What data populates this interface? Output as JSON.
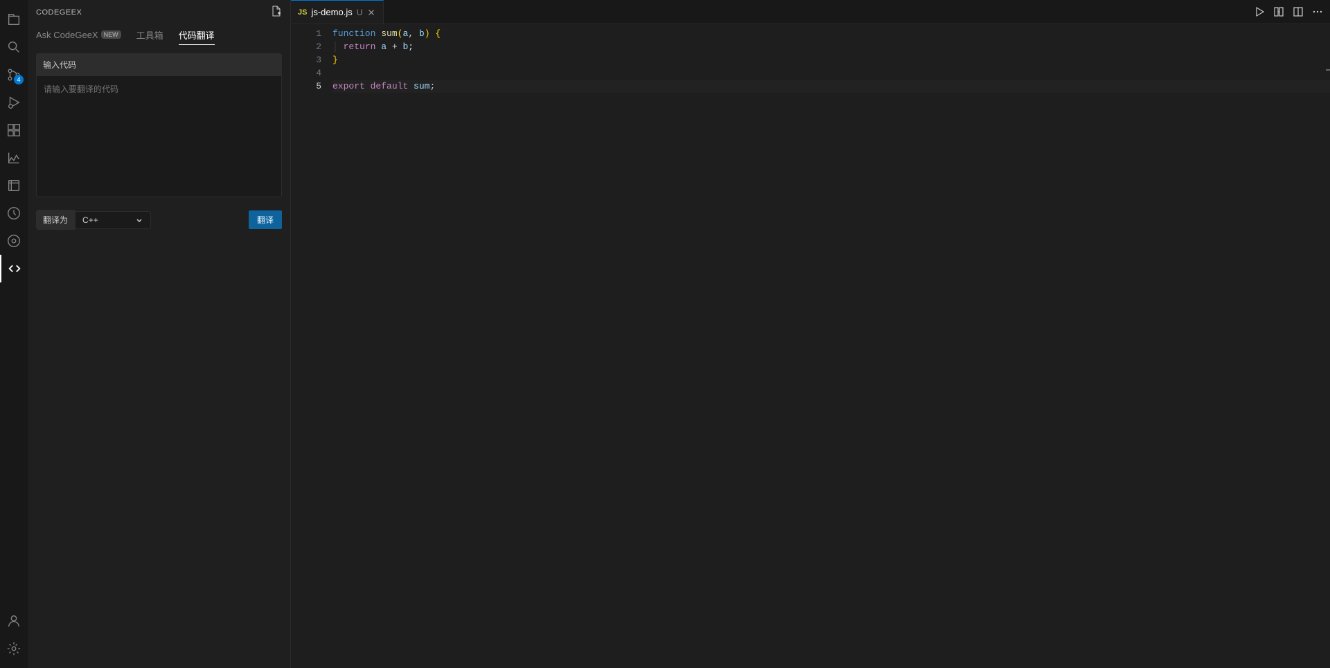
{
  "sidebar": {
    "title": "CODEGEEX",
    "tabs": [
      {
        "label": "Ask CodeGeeX",
        "badge": "NEW"
      },
      {
        "label": "工具箱"
      },
      {
        "label": "代码翻译"
      }
    ],
    "activeTabIndex": 2,
    "inputSection": {
      "label": "输入代码",
      "placeholder": "请输入要翻译的代码"
    },
    "translateLabel": "翻译为",
    "selectedLang": "C++",
    "translateButton": "翻译"
  },
  "activityBar": {
    "scmBadge": "4"
  },
  "editor": {
    "tabs": [
      {
        "icon": "JS",
        "name": "js-demo.js",
        "modified": "U"
      }
    ],
    "activeLine": 5,
    "code": {
      "line1": {
        "kw": "function",
        "fn": "sum",
        "p1": "(",
        "a": "a",
        "c1": ", ",
        "b": "b",
        "p2": ")",
        "sp": " ",
        "br": "{"
      },
      "line2": {
        "indent": "  ",
        "kw": "return",
        "sp": " ",
        "a": "a",
        "op": " + ",
        "b": "b",
        "semi": ";"
      },
      "line3": {
        "br": "}"
      },
      "line5": {
        "kw1": "export",
        "sp1": " ",
        "kw2": "default",
        "sp2": " ",
        "v": "sum",
        "semi": ";"
      }
    }
  }
}
